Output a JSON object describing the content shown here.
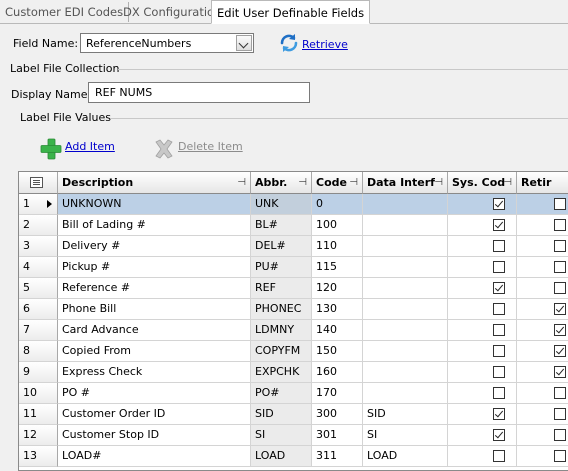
{
  "tabs": [
    {
      "label": "Customer EDI Codes",
      "active": false
    },
    {
      "label": "DX Configuration",
      "active": false
    },
    {
      "label": "Edit User Definable Fields",
      "active": true
    }
  ],
  "field": {
    "label": "Field Name:",
    "value": "ReferenceNumbers"
  },
  "retrieve": {
    "label": "Retrieve",
    "icon": "refresh-icon"
  },
  "label_collection": {
    "title": "Label File Collection"
  },
  "display_name": {
    "label": "Display Name:",
    "value": "REF NUMS"
  },
  "label_values": {
    "title": "Label File Values"
  },
  "toolbar": {
    "add_label": "Add Item",
    "add_icon": "plus-icon",
    "delete_label": "Delete Item",
    "delete_icon": "delete-x-icon",
    "accent_green": "#3bb34a",
    "link_color": "#0000cc"
  },
  "grid": {
    "columns": [
      "Description",
      "Abbr.",
      "Code",
      "Data Interf",
      "Sys. Cod",
      "Retir"
    ],
    "selected_row_color": "#bcd0e6",
    "rows": [
      {
        "num": "1",
        "desc": "UNKNOWN",
        "abbr": "UNK",
        "code": "0",
        "interf": "",
        "sys": true,
        "retired": false,
        "selected": true
      },
      {
        "num": "2",
        "desc": "Bill of Lading #",
        "abbr": "BL#",
        "code": "100",
        "interf": "",
        "sys": true,
        "retired": false
      },
      {
        "num": "3",
        "desc": "Delivery #",
        "abbr": "DEL#",
        "code": "110",
        "interf": "",
        "sys": false,
        "retired": false
      },
      {
        "num": "4",
        "desc": "Pickup #",
        "abbr": "PU#",
        "code": "115",
        "interf": "",
        "sys": false,
        "retired": false
      },
      {
        "num": "5",
        "desc": "Reference #",
        "abbr": "REF",
        "code": "120",
        "interf": "",
        "sys": true,
        "retired": false
      },
      {
        "num": "6",
        "desc": "Phone Bill",
        "abbr": "PHONEC",
        "code": "130",
        "interf": "",
        "sys": false,
        "retired": true
      },
      {
        "num": "7",
        "desc": "Card Advance",
        "abbr": "LDMNY",
        "code": "140",
        "interf": "",
        "sys": false,
        "retired": true
      },
      {
        "num": "8",
        "desc": "Copied From",
        "abbr": "COPYFM",
        "code": "150",
        "interf": "",
        "sys": false,
        "retired": true
      },
      {
        "num": "9",
        "desc": "Express Check",
        "abbr": "EXPCHK",
        "code": "160",
        "interf": "",
        "sys": false,
        "retired": true
      },
      {
        "num": "10",
        "desc": "PO #",
        "abbr": "PO#",
        "code": "170",
        "interf": "",
        "sys": false,
        "retired": false
      },
      {
        "num": "11",
        "desc": "Customer Order ID",
        "abbr": "SID",
        "code": "300",
        "interf": "SID",
        "sys": true,
        "retired": false
      },
      {
        "num": "12",
        "desc": "Customer Stop ID",
        "abbr": "SI",
        "code": "301",
        "interf": "SI",
        "sys": true,
        "retired": false
      },
      {
        "num": "13",
        "desc": "LOAD#",
        "abbr": "LOAD",
        "code": "311",
        "interf": "LOAD",
        "sys": false,
        "retired": false
      }
    ]
  }
}
